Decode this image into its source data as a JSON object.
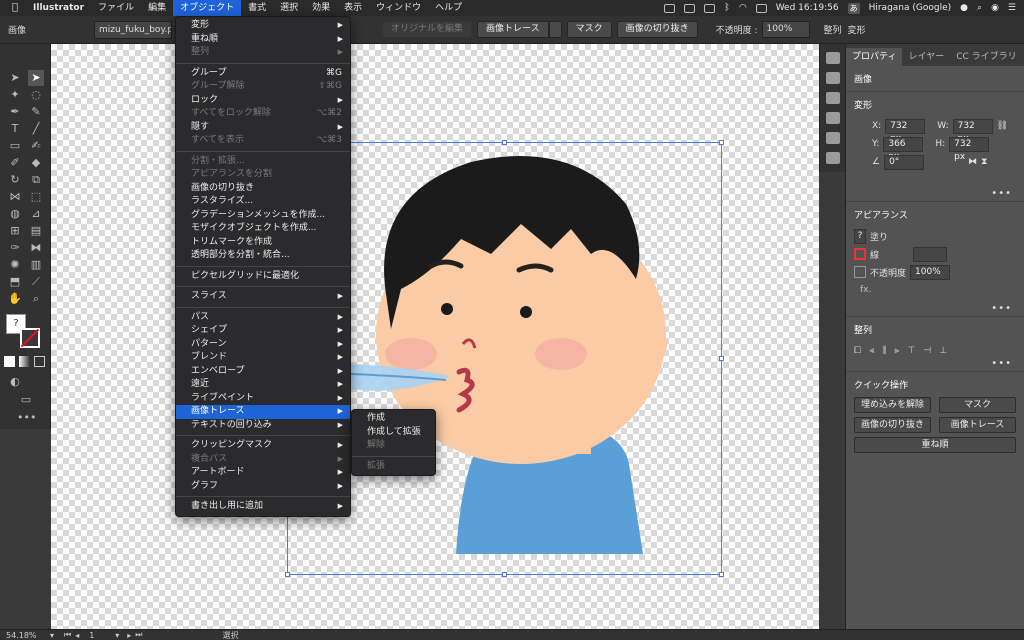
{
  "menubar": {
    "apple": "",
    "items": [
      "Illustrator",
      "ファイル",
      "編集",
      "オブジェクト",
      "書式",
      "選択",
      "効果",
      "表示",
      "ウィンドウ",
      "ヘルプ"
    ],
    "active_index": 3,
    "clock": "Wed 16:19:56",
    "ime": "Hiragana (Google)",
    "ime_badge": "あ"
  },
  "controlbar": {
    "type_label": "画像",
    "filename": "mizu_fuku_boy.png",
    "embed_original": "オリジナルを編集",
    "image_trace": "画像トレース",
    "mask": "マスク",
    "crop": "画像の切り抜き",
    "opacity_label": "不透明度 :",
    "opacity_value": "100%",
    "align": "整列",
    "transform": "変形"
  },
  "object_menu": [
    {
      "label": "変形",
      "sub": true
    },
    {
      "label": "重ね順",
      "sub": true
    },
    {
      "label": "整列",
      "sub": true,
      "disabled": true
    },
    {
      "sep": true
    },
    {
      "label": "グループ",
      "shortcut": "⌘G"
    },
    {
      "label": "グループ解除",
      "shortcut": "⇧⌘G",
      "disabled": true
    },
    {
      "label": "ロック",
      "sub": true
    },
    {
      "label": "すべてをロック解除",
      "shortcut": "⌥⌘2",
      "disabled": true
    },
    {
      "label": "隠す",
      "sub": true
    },
    {
      "label": "すべてを表示",
      "shortcut": "⌥⌘3",
      "disabled": true
    },
    {
      "sep": true
    },
    {
      "label": "分割・拡張...",
      "disabled": true
    },
    {
      "label": "アピアランスを分割",
      "disabled": true
    },
    {
      "label": "画像の切り抜き"
    },
    {
      "label": "ラスタライズ..."
    },
    {
      "label": "グラデーションメッシュを作成..."
    },
    {
      "label": "モザイクオブジェクトを作成..."
    },
    {
      "label": "トリムマークを作成"
    },
    {
      "label": "透明部分を分割・統合..."
    },
    {
      "sep": true
    },
    {
      "label": "ピクセルグリッドに最適化"
    },
    {
      "sep": true
    },
    {
      "label": "スライス",
      "sub": true
    },
    {
      "sep": true
    },
    {
      "label": "パス",
      "sub": true
    },
    {
      "label": "シェイプ",
      "sub": true
    },
    {
      "label": "パターン",
      "sub": true
    },
    {
      "label": "ブレンド",
      "sub": true
    },
    {
      "label": "エンベロープ",
      "sub": true
    },
    {
      "label": "遠近",
      "sub": true
    },
    {
      "label": "ライブペイント",
      "sub": true
    },
    {
      "label": "画像トレース",
      "sub": true,
      "highlight": true
    },
    {
      "label": "テキストの回り込み",
      "sub": true
    },
    {
      "sep": true
    },
    {
      "label": "クリッピングマスク",
      "sub": true
    },
    {
      "label": "複合パス",
      "sub": true,
      "disabled": true
    },
    {
      "label": "アートボード",
      "sub": true
    },
    {
      "label": "グラフ",
      "sub": true
    },
    {
      "sep": true
    },
    {
      "label": "書き出し用に追加",
      "sub": true
    }
  ],
  "trace_submenu": [
    {
      "label": "作成"
    },
    {
      "label": "作成して拡張"
    },
    {
      "label": "解除",
      "disabled": true
    },
    {
      "sep": true
    },
    {
      "label": "拡張",
      "disabled": true
    }
  ],
  "properties": {
    "tabs": [
      "プロパティ",
      "レイヤー",
      "CC ライブラリ"
    ],
    "object_type": "画像",
    "transform_title": "変形",
    "x_label": "X:",
    "x": "732 px",
    "y_label": "Y:",
    "y": "366 px",
    "w_label": "W:",
    "w": "732 px",
    "h_label": "H:",
    "h": "732 px",
    "angle": "0°",
    "appearance_title": "アピアランス",
    "fill_label": "塗り",
    "stroke_label": "線",
    "opacity_label": "不透明度",
    "opacity_value": "100%",
    "fx": "fx.",
    "align_title": "整列",
    "quick_title": "クイック操作",
    "quick": [
      "埋め込みを解除",
      "マスク",
      "画像の切り抜き",
      "画像トレース",
      "重ね順"
    ]
  },
  "statusbar": {
    "zoom": "54.18%",
    "artboard": "1",
    "tool": "選択"
  },
  "colors": {
    "highlight": "#1f63d8",
    "selection": "#4d7fe0"
  }
}
